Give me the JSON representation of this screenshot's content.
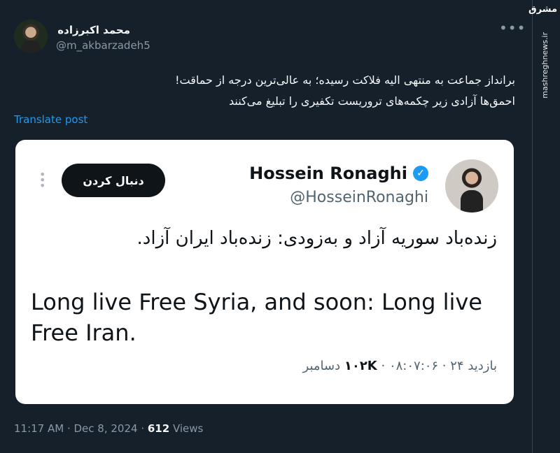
{
  "author": {
    "name": "محمد اکبرزاده",
    "handle": "@m_akbarzadeh5",
    "more_icon": "more-horizontal-icon"
  },
  "post": {
    "line1": "برانداز جماعت به منتهی الیه فلاکت رسیده؛ به عالی‌ترین درجه از حماقت!",
    "line2": "احمق‌ها آزادی زیر چکمه‌های تروریست تکفیری را تبلیغ می‌کنند",
    "translate": "Translate post"
  },
  "quoted": {
    "name": "Hossein Ronaghi",
    "handle": "@HosseinRonaghi",
    "follow_label": "دنبال کردن",
    "text_fa": "زنده‌باد سوریه آزاد و به‌زودی: زنده‌باد ایران آزاد.",
    "text_en": "Long live Free Syria, and soon: Long live Free Iran.",
    "views_label": "بازدید",
    "views_count": "۱۰۲K",
    "timestamp": "۰۸:۰۷:۰۶ · ۲۴ دسامبر"
  },
  "footer": {
    "time": "11:17 AM · Dec 8, 2024 · ",
    "views_count": "612",
    "views_label": " Views"
  },
  "watermark": {
    "logo": "مشرق",
    "site": "mashreghnews.ir"
  },
  "colors": {
    "background": "#15202b",
    "accent": "#1d9bf0",
    "muted": "#8b98a5"
  }
}
